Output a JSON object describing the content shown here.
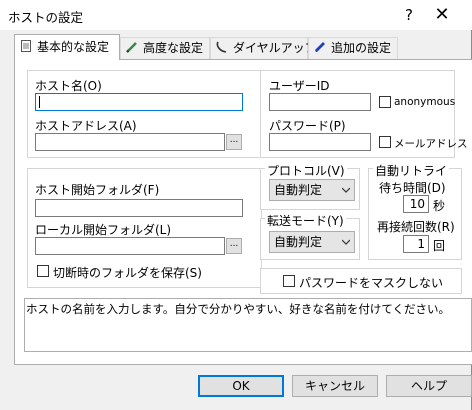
{
  "window": {
    "title": "ホストの設定",
    "help_glyph": "?",
    "close_glyph": "✕"
  },
  "tabs": [
    {
      "label": "基本的な設定",
      "icon": "document-icon",
      "active": true
    },
    {
      "label": "高度な設定",
      "icon": "pen-icon",
      "active": false
    },
    {
      "label": "ダイヤルアップ",
      "icon": "phone-icon",
      "active": false
    },
    {
      "label": "追加の設定",
      "icon": "fountain-pen-icon",
      "active": false
    }
  ],
  "basic": {
    "host_name_label": "ホスト名(O)",
    "host_name_value": "",
    "host_address_label": "ホストアドレス(A)",
    "host_address_value": "",
    "browse_label": "...",
    "user_id_label": "ユーザーID",
    "user_id_value": "",
    "anonymous_label": "anonymous",
    "password_label": "パスワード(P)",
    "password_value": "",
    "mail_address_label": "メールアドレス",
    "host_start_folder_label": "ホスト開始フォルダ(F)",
    "host_start_folder_value": "",
    "local_start_folder_label": "ローカル開始フォルダ(L)",
    "local_start_folder_value": "",
    "save_folder_label": "切断時のフォルダを保存(S)",
    "protocol_label": "プロトコル(V)",
    "protocol_value": "自動判定",
    "transfer_mode_label": "転送モード(Y)",
    "transfer_mode_value": "自動判定",
    "auto_retry_label": "自動リトライ",
    "wait_time_label": "待ち時間(D)",
    "wait_time_value": "10",
    "wait_time_unit": "秒",
    "reconnect_count_label": "再接続回数(R)",
    "reconnect_count_value": "1",
    "reconnect_count_unit": "回",
    "mask_password_label": "パスワードをマスクしない"
  },
  "description": "ホストの名前を入力します。自分で分かりやすい、好きな名前を付けてください。",
  "buttons": {
    "ok": "OK",
    "cancel": "キャンセル",
    "help": "ヘルプ"
  },
  "colors": {
    "accent": "#0078d7",
    "dialog_bg": "#f0f0f0",
    "panel_bg": "#ffffff"
  }
}
